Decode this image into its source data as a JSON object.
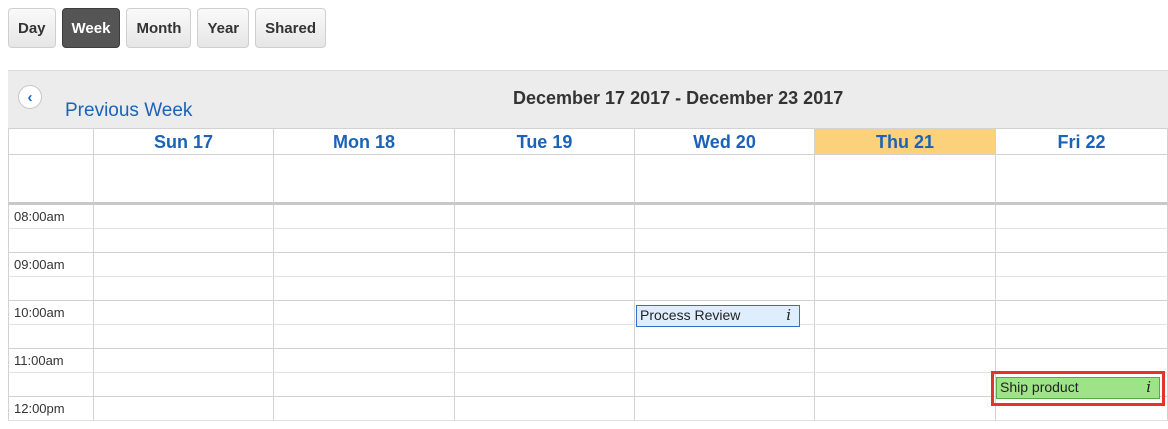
{
  "view_tabs": [
    {
      "label": "Day",
      "active": false
    },
    {
      "label": "Week",
      "active": true
    },
    {
      "label": "Month",
      "active": false
    },
    {
      "label": "Year",
      "active": false
    },
    {
      "label": "Shared",
      "active": false
    }
  ],
  "header": {
    "prev_label": "Previous Week",
    "prev_icon": "chevron-left-icon",
    "range_title": "December 17 2017 - December 23 2017"
  },
  "days": [
    {
      "label": "Sun 17",
      "today": false
    },
    {
      "label": "Mon 18",
      "today": false
    },
    {
      "label": "Tue 19",
      "today": false
    },
    {
      "label": "Wed 20",
      "today": false
    },
    {
      "label": "Thu 21",
      "today": true
    },
    {
      "label": "Fri 22",
      "today": false
    }
  ],
  "times": [
    "08:00am",
    "09:00am",
    "10:00am",
    "11:00am",
    "12:00pm"
  ],
  "events": [
    {
      "title": "Process Review",
      "day": "Wed 20",
      "time": "10:00am",
      "info_glyph": "i"
    },
    {
      "title": "Ship product",
      "day": "Fri 22",
      "time": "11:30am",
      "info_glyph": "i",
      "highlighted": true
    }
  ],
  "colors": {
    "link_blue": "#1b62b8",
    "today_bg": "#fbd17b",
    "review_event_bg": "#dfeefd",
    "ship_event_bg": "#9ee387",
    "highlight_border": "#e0342c",
    "active_tab_bg": "#555555"
  }
}
